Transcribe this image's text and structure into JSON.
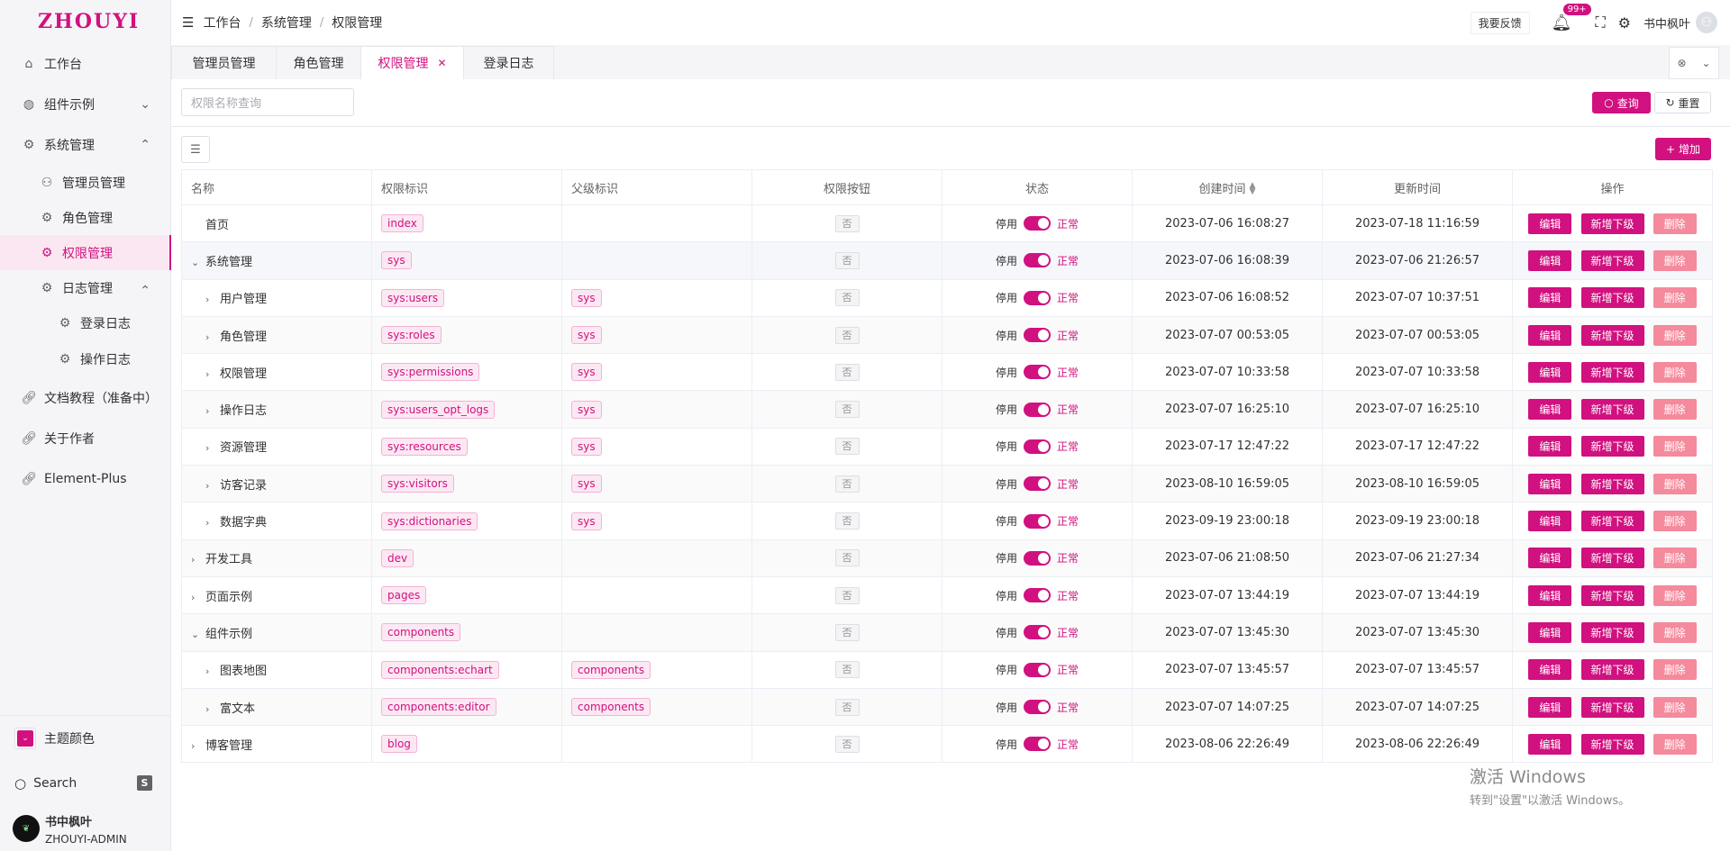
{
  "sidebar": {
    "logo": "ZHOUYI",
    "items": [
      {
        "label": "工作台"
      },
      {
        "label": "组件示例"
      },
      {
        "label": "系统管理"
      },
      {
        "label": "管理员管理"
      },
      {
        "label": "角色管理"
      },
      {
        "label": "权限管理"
      },
      {
        "label": "日志管理"
      },
      {
        "label": "登录日志"
      },
      {
        "label": "操作日志"
      },
      {
        "label": "文档教程（准备中）"
      },
      {
        "label": "关于作者"
      },
      {
        "label": "Element-Plus"
      }
    ],
    "theme_label": "主题颜色",
    "search_label": "Search",
    "search_key": "S",
    "user_name": "书中枫叶",
    "user_role": "ZHOUYI-ADMIN"
  },
  "header": {
    "breadcrumb": [
      "工作台",
      "系统管理",
      "权限管理"
    ],
    "feedback": "我要反馈",
    "badge": "99+",
    "user_name": "书中枫叶"
  },
  "tabs": [
    {
      "label": "管理员管理"
    },
    {
      "label": "角色管理"
    },
    {
      "label": "权限管理"
    },
    {
      "label": "登录日志"
    }
  ],
  "filter": {
    "placeholder": "权限名称查询",
    "query": "查询",
    "reset": "重置",
    "add": "增加"
  },
  "table": {
    "headers": [
      "名称",
      "权限标识",
      "父级标识",
      "权限按钮",
      "状态",
      "创建时间",
      "更新时间",
      "操作"
    ],
    "status_off": "停用",
    "status_on": "正常",
    "btn_edit": "编辑",
    "btn_child": "新增下级",
    "btn_delete": "删除",
    "rows": [
      {
        "name": "首页",
        "perm": "index",
        "parent": "",
        "button": "否",
        "created": "2023-07-06 16:08:27",
        "updated": "2023-07-18 11:16:59",
        "level": 0,
        "arrow": ""
      },
      {
        "name": "系统管理",
        "perm": "sys",
        "parent": "",
        "button": "否",
        "created": "2023-07-06 16:08:39",
        "updated": "2023-07-06 21:26:57",
        "level": 0,
        "arrow": "down"
      },
      {
        "name": "用户管理",
        "perm": "sys:users",
        "parent": "sys",
        "button": "否",
        "created": "2023-07-06 16:08:52",
        "updated": "2023-07-07 10:37:51",
        "level": 1,
        "arrow": "right"
      },
      {
        "name": "角色管理",
        "perm": "sys:roles",
        "parent": "sys",
        "button": "否",
        "created": "2023-07-07 00:53:05",
        "updated": "2023-07-07 00:53:05",
        "level": 1,
        "arrow": "right"
      },
      {
        "name": "权限管理",
        "perm": "sys:permissions",
        "parent": "sys",
        "button": "否",
        "created": "2023-07-07 10:33:58",
        "updated": "2023-07-07 10:33:58",
        "level": 1,
        "arrow": "right"
      },
      {
        "name": "操作日志",
        "perm": "sys:users_opt_logs",
        "parent": "sys",
        "button": "否",
        "created": "2023-07-07 16:25:10",
        "updated": "2023-07-07 16:25:10",
        "level": 1,
        "arrow": "right"
      },
      {
        "name": "资源管理",
        "perm": "sys:resources",
        "parent": "sys",
        "button": "否",
        "created": "2023-07-17 12:47:22",
        "updated": "2023-07-17 12:47:22",
        "level": 1,
        "arrow": "right"
      },
      {
        "name": "访客记录",
        "perm": "sys:visitors",
        "parent": "sys",
        "button": "否",
        "created": "2023-08-10 16:59:05",
        "updated": "2023-08-10 16:59:05",
        "level": 1,
        "arrow": "right"
      },
      {
        "name": "数据字典",
        "perm": "sys:dictionaries",
        "parent": "sys",
        "button": "否",
        "created": "2023-09-19 23:00:18",
        "updated": "2023-09-19 23:00:18",
        "level": 1,
        "arrow": "right"
      },
      {
        "name": "开发工具",
        "perm": "dev",
        "parent": "",
        "button": "否",
        "created": "2023-07-06 21:08:50",
        "updated": "2023-07-06 21:27:34",
        "level": 0,
        "arrow": "right"
      },
      {
        "name": "页面示例",
        "perm": "pages",
        "parent": "",
        "button": "否",
        "created": "2023-07-07 13:44:19",
        "updated": "2023-07-07 13:44:19",
        "level": 0,
        "arrow": "right"
      },
      {
        "name": "组件示例",
        "perm": "components",
        "parent": "",
        "button": "否",
        "created": "2023-07-07 13:45:30",
        "updated": "2023-07-07 13:45:30",
        "level": 0,
        "arrow": "down"
      },
      {
        "name": "图表地图",
        "perm": "components:echart",
        "parent": "components",
        "button": "否",
        "created": "2023-07-07 13:45:57",
        "updated": "2023-07-07 13:45:57",
        "level": 1,
        "arrow": "right"
      },
      {
        "name": "富文本",
        "perm": "components:editor",
        "parent": "components",
        "button": "否",
        "created": "2023-07-07 14:07:25",
        "updated": "2023-07-07 14:07:25",
        "level": 1,
        "arrow": "right"
      },
      {
        "name": "博客管理",
        "perm": "blog",
        "parent": "",
        "button": "否",
        "created": "2023-08-06 22:26:49",
        "updated": "2023-08-06 22:26:49",
        "level": 0,
        "arrow": "right"
      }
    ]
  },
  "os_watermark": {
    "line1": "激活 Windows",
    "line2": "转到\"设置\"以激活 Windows。"
  },
  "colors": {
    "accent": "#d1117f",
    "danger": "#f48a9c"
  }
}
